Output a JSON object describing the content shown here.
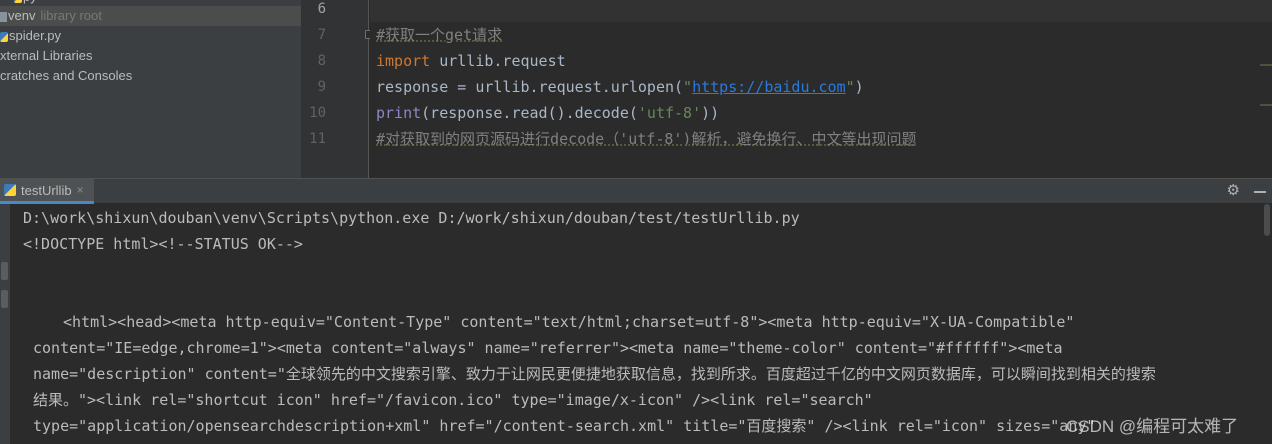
{
  "project_tree": {
    "items": [
      {
        "label": "venv",
        "annotation": "library root"
      },
      {
        "label": "spider.py"
      },
      {
        "label": "xternal Libraries"
      },
      {
        "label": "cratches and Consoles"
      }
    ]
  },
  "editor": {
    "line_numbers": [
      "6",
      "7",
      "8",
      "9",
      "10",
      "11"
    ],
    "lines": {
      "l7": {
        "comment": "#获取一个get请求"
      },
      "l8": {
        "keyword": "import",
        "module": " urllib.request"
      },
      "l9": {
        "code": "response = urllib.request.urlopen(",
        "quote_open": "\"",
        "url": "https://baidu.com",
        "quote_close": "\"",
        "paren": ")"
      },
      "l10": {
        "builtin": "print",
        "code": "(response.read().decode(",
        "string": "'utf-8'",
        "close": "))"
      },
      "l11": {
        "comment": "#对获取到的网页源码进行decode（'utf-8')解析，避免换行、中文等出现问题"
      }
    }
  },
  "run": {
    "tab_label": "testUrllib",
    "tab_close": "×",
    "settings_icon_glyph": "⚙",
    "console_lines": [
      "D:\\work\\shixun\\douban\\venv\\Scripts\\python.exe D:/work/shixun/douban/test/testUrllib.py",
      "<!DOCTYPE html><!--STATUS OK-->",
      "<html><head><meta http-equiv=\"Content-Type\" content=\"text/html;charset=utf-8\"><meta http-equiv=\"X-UA-Compatible\"",
      "content=\"IE=edge,chrome=1\"><meta content=\"always\" name=\"referrer\"><meta name=\"theme-color\" content=\"#ffffff\"><meta",
      "name=\"description\" content=\"全球领先的中文搜索引擎、致力于让网民更便捷地获取信息，找到所求。百度超过千亿的中文网页数据库，可以瞬间找到相关的搜索",
      "结果。\"><link rel=\"shortcut icon\" href=\"/favicon.ico\" type=\"image/x-icon\" /><link rel=\"search\"",
      "type=\"application/opensearchdescription+xml\" href=\"/content-search.xml\" title=\"百度搜索\" /><link rel=\"icon\" sizes=\"any\""
    ]
  },
  "watermark": "CSDN @编程可太难了"
}
